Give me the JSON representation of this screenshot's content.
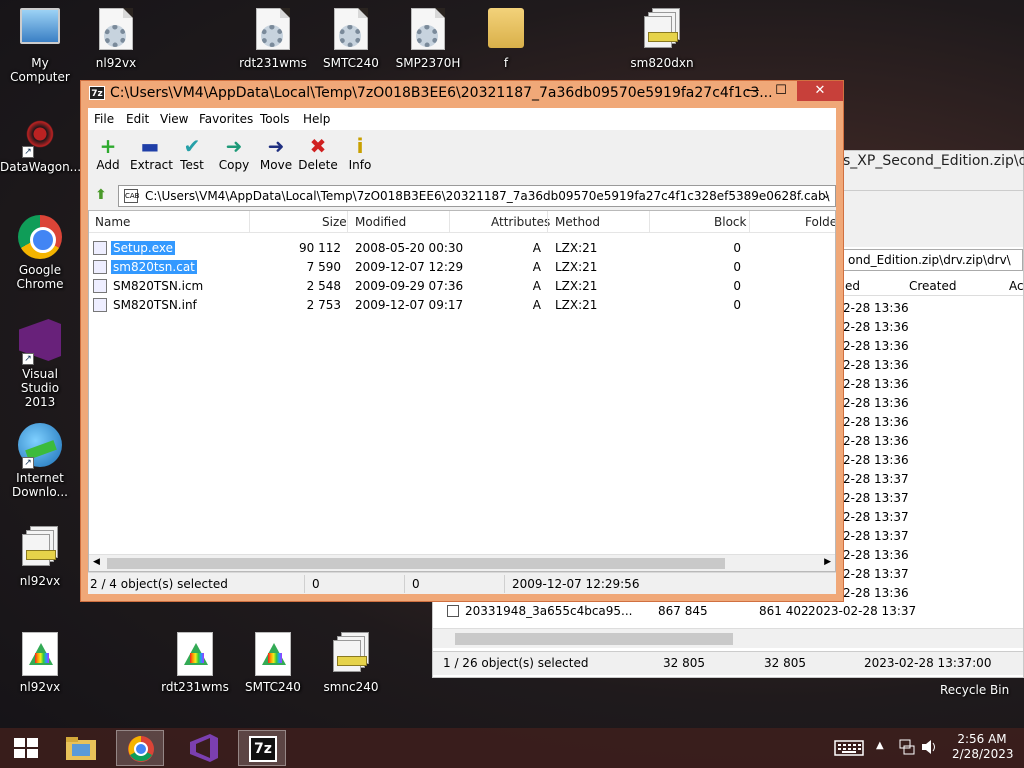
{
  "desktop": {
    "icons_top": [
      {
        "label": "My Computer"
      },
      {
        "label": "nl92vx"
      },
      {
        "label": "rdt231wms"
      },
      {
        "label": "SMTC240"
      },
      {
        "label": "SMP2370H"
      },
      {
        "label": "f"
      },
      {
        "label": "sm820dxn"
      }
    ],
    "icons_left": [
      {
        "label": "DataWagon..."
      },
      {
        "label": "Google Chrome"
      },
      {
        "label": "Visual Studio 2013"
      },
      {
        "label": "Internet Downlo..."
      },
      {
        "label": "nl92vx"
      }
    ],
    "icons_bottom": [
      {
        "label": "nl92vx"
      },
      {
        "label": "rdt231wms"
      },
      {
        "label": "SMTC240"
      },
      {
        "label": "smnc240"
      }
    ],
    "recycle_bin": "Recycle Bin"
  },
  "bg_window": {
    "title_fragment": "s_XP_Second_Edition.zip\\drv",
    "address_fragment": "ond_Edition.zip\\drv.zip\\drv\\",
    "headers": [
      "ed",
      "Created",
      "Ac"
    ],
    "times": [
      "2-28 13:36",
      "2-28 13:36",
      "2-28 13:36",
      "2-28 13:36",
      "2-28 13:36",
      "2-28 13:36",
      "2-28 13:36",
      "2-28 13:36",
      "2-28 13:36",
      "2-28 13:37",
      "2-28 13:37",
      "2-28 13:37",
      "2-28 13:37",
      "2-28 13:36",
      "2-28 13:37",
      "2-28 13:36"
    ],
    "bottom_row": {
      "name": "20331948_3a655c4bca95...",
      "size": "867 845",
      "packed": "861 402",
      "modified": "2023-02-28 13:37"
    },
    "status": {
      "selected": "1 / 26 object(s) selected",
      "size": "32 805",
      "packed": "32 805",
      "modified": "2023-02-28 13:37:00"
    }
  },
  "window": {
    "title": "C:\\Users\\VM4\\AppData\\Local\\Temp\\7zO018B3EE6\\20321187_7a36db09570e5919fa27c4f1c3...",
    "app_icon": "7z",
    "buttons": {
      "minimize": "—",
      "maximize": "☐",
      "close": "✕"
    },
    "menu": [
      "File",
      "Edit",
      "View",
      "Favorites",
      "Tools",
      "Help"
    ],
    "toolbar": [
      {
        "label": "Add",
        "icon": "+",
        "color": "#2eaa2e"
      },
      {
        "label": "Extract",
        "icon": "▬",
        "color": "#1f3fa8"
      },
      {
        "label": "Test",
        "icon": "✔",
        "color": "#26a0a8"
      },
      {
        "label": "Copy",
        "icon": "➜",
        "color": "#1e9a78"
      },
      {
        "label": "Move",
        "icon": "➜",
        "color": "#1f2f80"
      },
      {
        "label": "Delete",
        "icon": "✖",
        "color": "#d02020"
      },
      {
        "label": "Info",
        "icon": "i",
        "color": "#c8a000"
      }
    ],
    "address": "C:\\Users\\VM4\\AppData\\Local\\Temp\\7zO018B3EE6\\20321187_7a36db09570e5919fa27c4f1c328ef5389e0628f.cab\\",
    "columns": [
      "Name",
      "Size",
      "Modified",
      "Attributes",
      "Method",
      "Block",
      "Folder"
    ],
    "files": [
      {
        "name": "Setup.exe",
        "size": "90 112",
        "modified": "2008-05-20 00:30",
        "attr": "A",
        "method": "LZX:21",
        "block": "0",
        "selected": true
      },
      {
        "name": "sm820tsn.cat",
        "size": "7 590",
        "modified": "2009-12-07 12:29",
        "attr": "A",
        "method": "LZX:21",
        "block": "0",
        "selected": true
      },
      {
        "name": "SM820TSN.icm",
        "size": "2 548",
        "modified": "2009-09-29 07:36",
        "attr": "A",
        "method": "LZX:21",
        "block": "0",
        "selected": false
      },
      {
        "name": "SM820TSN.inf",
        "size": "2 753",
        "modified": "2009-12-07 09:17",
        "attr": "A",
        "method": "LZX:21",
        "block": "0",
        "selected": false
      }
    ],
    "status": {
      "selected": "2 / 4 object(s) selected",
      "size": "0",
      "packed": "0",
      "modified": "2009-12-07 12:29:56"
    }
  },
  "taskbar": {
    "apps": [
      {
        "name": "start-button"
      },
      {
        "name": "file-explorer"
      },
      {
        "name": "google-chrome"
      },
      {
        "name": "visual-studio"
      },
      {
        "name": "7-zip"
      }
    ],
    "seven_zip_label": "7z",
    "time": "2:56 AM",
    "date": "2/28/2023"
  }
}
